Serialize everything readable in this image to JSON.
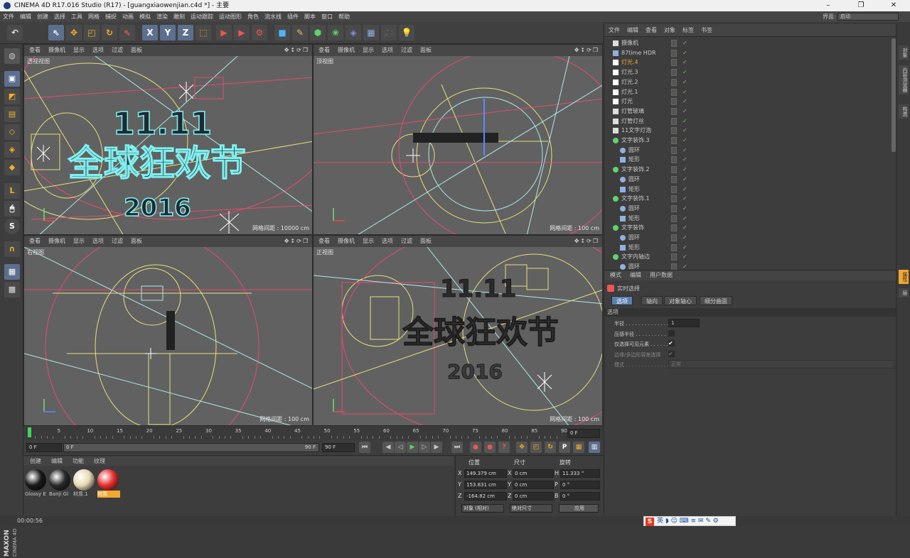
{
  "window": {
    "title": "CINEMA 4D R17.016 Studio (R17) - [guangxiaowenjian.c4d *] - 主要"
  },
  "menu": [
    "文件",
    "编辑",
    "创建",
    "选择",
    "工具",
    "网格",
    "捕捉",
    "动画",
    "模拟",
    "渲染",
    "雕刻",
    "运动跟踪",
    "运动图形",
    "角色",
    "流水线",
    "插件",
    "脚本",
    "窗口",
    "帮助"
  ],
  "layout": {
    "label": "界面:",
    "value": "启动"
  },
  "toolbar": {
    "icons": [
      "undo-icon",
      "select-live-icon",
      "move-icon",
      "scale-icon",
      "rotate-icon",
      "recent-tool-icon",
      "x-axis-icon",
      "y-axis-icon",
      "z-axis-icon",
      "coord-system-icon",
      "render-region-icon",
      "render-view-icon",
      "render-settings-icon",
      "cube-icon",
      "pen-icon",
      "subdivide-icon",
      "cloner-icon",
      "deformer-icon",
      "floor-icon",
      "camera-icon",
      "light-icon"
    ],
    "axis_x": "X",
    "axis_y": "Y",
    "axis_z": "Z"
  },
  "viewport_menu": [
    "查看",
    "摄像机",
    "显示",
    "选项",
    "过滤",
    "面板"
  ],
  "viewports": [
    {
      "name": "透视视图",
      "grid": "网格间距 : 10000 cm"
    },
    {
      "name": "顶视图",
      "grid": "网格间距 : 100 cm"
    },
    {
      "name": "右视图",
      "grid": "网格间距 : 100 cm"
    },
    {
      "name": "正视图",
      "grid": "网格间距 : 100 cm"
    }
  ],
  "scene_text": {
    "line1": "11.11",
    "line2": "全球狂欢节",
    "line3": "2016"
  },
  "timeline": {
    "ticks": [
      "0",
      "5",
      "10",
      "15",
      "20",
      "25",
      "30",
      "35",
      "40",
      "45",
      "50",
      "55",
      "60",
      "65",
      "70",
      "75",
      "80",
      "85",
      "90"
    ],
    "current": "0 F",
    "start": "0 F",
    "min": "0 F",
    "max": "90 F",
    "end": "90 F",
    "playhead": 0,
    "max_frame": 90
  },
  "materials": {
    "menu": [
      "创建",
      "编辑",
      "功能",
      "纹理"
    ],
    "items": [
      {
        "label": "Glossy E",
        "color": "#1a1a1a"
      },
      {
        "label": "Banji Gl",
        "color": "#2a2a2a"
      },
      {
        "label": "材质.1",
        "color": "#e8d9b5"
      },
      {
        "label": "材质",
        "color": "#e83030",
        "selected": true
      }
    ]
  },
  "coords": {
    "headers": [
      "位置",
      "尺寸",
      "旋转"
    ],
    "rows": [
      {
        "axis": "X",
        "pos": "149.379 cm",
        "size": "0 cm",
        "rot_label": "H",
        "rot": "11.333 °"
      },
      {
        "axis": "Y",
        "pos": "153.831 cm",
        "size": "0 cm",
        "rot_label": "P",
        "rot": "0 °"
      },
      {
        "axis": "Z",
        "pos": "-164.82 cm",
        "size": "0 cm",
        "rot_label": "B",
        "rot": "0 °"
      }
    ],
    "mode": "对象 (相对)",
    "size_mode": "绝对尺寸",
    "apply": "应用"
  },
  "objects": {
    "menu": [
      "文件",
      "编辑",
      "查看",
      "对象",
      "标签",
      "书签"
    ],
    "items": [
      {
        "name": "摄像机",
        "indent": 0,
        "highlight": false,
        "type": "camera"
      },
      {
        "name": "87time HDR",
        "indent": 0,
        "highlight": false,
        "type": "sky"
      },
      {
        "name": "灯光.4",
        "indent": 0,
        "highlight": true,
        "type": "light"
      },
      {
        "name": "灯光.3",
        "indent": 0,
        "highlight": false,
        "type": "light"
      },
      {
        "name": "灯光.2",
        "indent": 0,
        "highlight": false,
        "type": "light"
      },
      {
        "name": "灯光.1",
        "indent": 0,
        "highlight": false,
        "type": "light"
      },
      {
        "name": "灯光",
        "indent": 0,
        "highlight": false,
        "type": "light"
      },
      {
        "name": "灯管玻璃",
        "indent": 0,
        "highlight": false,
        "type": "null"
      },
      {
        "name": "灯管灯丝",
        "indent": 0,
        "highlight": false,
        "type": "null"
      },
      {
        "name": "11文字灯泡",
        "indent": 0,
        "highlight": false,
        "type": "null"
      },
      {
        "name": "文字装饰.3",
        "indent": 0,
        "highlight": false,
        "type": "sweep"
      },
      {
        "name": "圆环",
        "indent": 1,
        "highlight": false,
        "type": "circle"
      },
      {
        "name": "矩形",
        "indent": 1,
        "highlight": false,
        "type": "rect"
      },
      {
        "name": "文字装饰.2",
        "indent": 0,
        "highlight": false,
        "type": "sweep"
      },
      {
        "name": "圆环",
        "indent": 1,
        "highlight": false,
        "type": "circle"
      },
      {
        "name": "矩形",
        "indent": 1,
        "highlight": false,
        "type": "rect"
      },
      {
        "name": "文字装饰.1",
        "indent": 0,
        "highlight": false,
        "type": "sweep"
      },
      {
        "name": "圆环",
        "indent": 1,
        "highlight": false,
        "type": "circle"
      },
      {
        "name": "矩形",
        "indent": 1,
        "highlight": false,
        "type": "rect"
      },
      {
        "name": "文字装饰",
        "indent": 0,
        "highlight": false,
        "type": "sweep"
      },
      {
        "name": "圆环",
        "indent": 1,
        "highlight": false,
        "type": "circle"
      },
      {
        "name": "矩形",
        "indent": 1,
        "highlight": false,
        "type": "rect"
      },
      {
        "name": "文字内轴边",
        "indent": 0,
        "highlight": false,
        "type": "sweep"
      },
      {
        "name": "圆环",
        "indent": 1,
        "highlight": false,
        "type": "circle"
      }
    ]
  },
  "attributes": {
    "menu": [
      "模式",
      "编辑",
      "用户数据"
    ],
    "tool": "实时选择",
    "tabs": [
      "选项",
      "轴向",
      "对象轴心",
      "细分曲面"
    ],
    "section": "选项",
    "rows": [
      {
        "label": "半径 . . . . . . . . . . . . . .",
        "value": "1"
      },
      {
        "label": "压感半径 . . . . . . . . . .",
        "value": ""
      },
      {
        "label": "仅选择可见元素 . . . . . .",
        "value": "✔"
      },
      {
        "label": "边缘/多边形容差选择",
        "value": "✔"
      },
      {
        "label": "模式 . . . . . . . . . . . . . .",
        "value": "正常"
      }
    ]
  },
  "right_tabs": [
    "对象",
    "内容浏览器",
    "构造",
    "属性",
    "层"
  ],
  "status": "00:00:56",
  "ime": {
    "logo": "S",
    "text": "英 ◗ ☺ ⌨ ≡ ✉ ✎ ⚙"
  },
  "colors": {
    "accent": "#5b7fb0",
    "highlight": "#f0a830",
    "check": "#6ccf5a"
  }
}
